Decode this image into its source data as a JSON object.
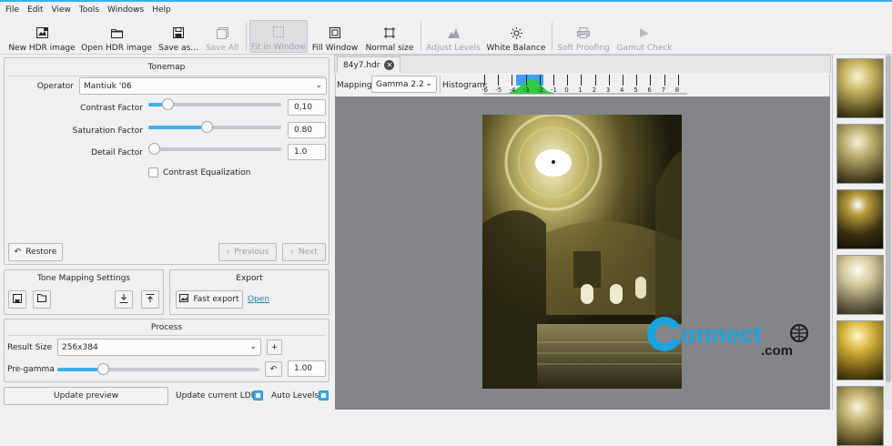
{
  "menu": [
    "File",
    "Edit",
    "View",
    "Tools",
    "Windows",
    "Help"
  ],
  "toolbar": {
    "new_hdr": "New HDR image",
    "open_hdr": "Open HDR image",
    "save_as": "Save as...",
    "save_all": "Save All",
    "fit_window": "Fit in Window",
    "fill_window": "Fill Window",
    "normal_size": "Normal size",
    "adjust_levels": "Adjust Levels",
    "white_balance": "White Balance",
    "soft_proofing": "Soft Proofing",
    "gamut_check": "Gamut Check"
  },
  "tonemap": {
    "title": "Tonemap",
    "operator_label": "Operator",
    "operator_value": "Mantiuk '06",
    "contrast_label": "Contrast Factor",
    "contrast_value": "0,10",
    "contrast_fraction": 0.1,
    "saturation_label": "Saturation Factor",
    "saturation_value": "0.80",
    "saturation_fraction": 0.4,
    "detail_label": "Detail Factor",
    "detail_value": "1.0",
    "detail_fraction": 0.0,
    "contrast_eq_label": "Contrast Equalization",
    "contrast_eq_checked": false,
    "restore_label": "Restore",
    "previous_label": "Previous",
    "next_label": "Next"
  },
  "tms": {
    "title": "Tone Mapping Settings"
  },
  "export": {
    "title": "Export",
    "fast_export_label": "Fast export",
    "open_label": "Open"
  },
  "process": {
    "title": "Process",
    "result_size_label": "Result Size",
    "result_size_value": "256x384",
    "pregamma_label": "Pre-gamma",
    "pregamma_value": "1.00",
    "pregamma_fraction": 0.2
  },
  "bottom": {
    "update_preview_label": "Update preview",
    "update_ldr_label": "Update current LDR",
    "update_ldr_checked": true,
    "auto_levels_label": "Auto Levels",
    "auto_levels_checked": true
  },
  "viewer": {
    "tab_label": "84y7.hdr",
    "mapping_label": "Mapping:",
    "mapping_value": "Gamma 2.2",
    "histogram_label": "Histogram:",
    "histogram_ticks": [
      "-6",
      "-5",
      "-4",
      "-3",
      "-2",
      "-1",
      "0",
      "1",
      "2",
      "3",
      "4",
      "5",
      "6",
      "7",
      "8"
    ]
  },
  "watermark": {
    "text": "onnect",
    "suffix": ".com"
  },
  "colors": {
    "accent": "#3daee9",
    "viewer_bg": "#848589",
    "link": "#2980b9"
  }
}
